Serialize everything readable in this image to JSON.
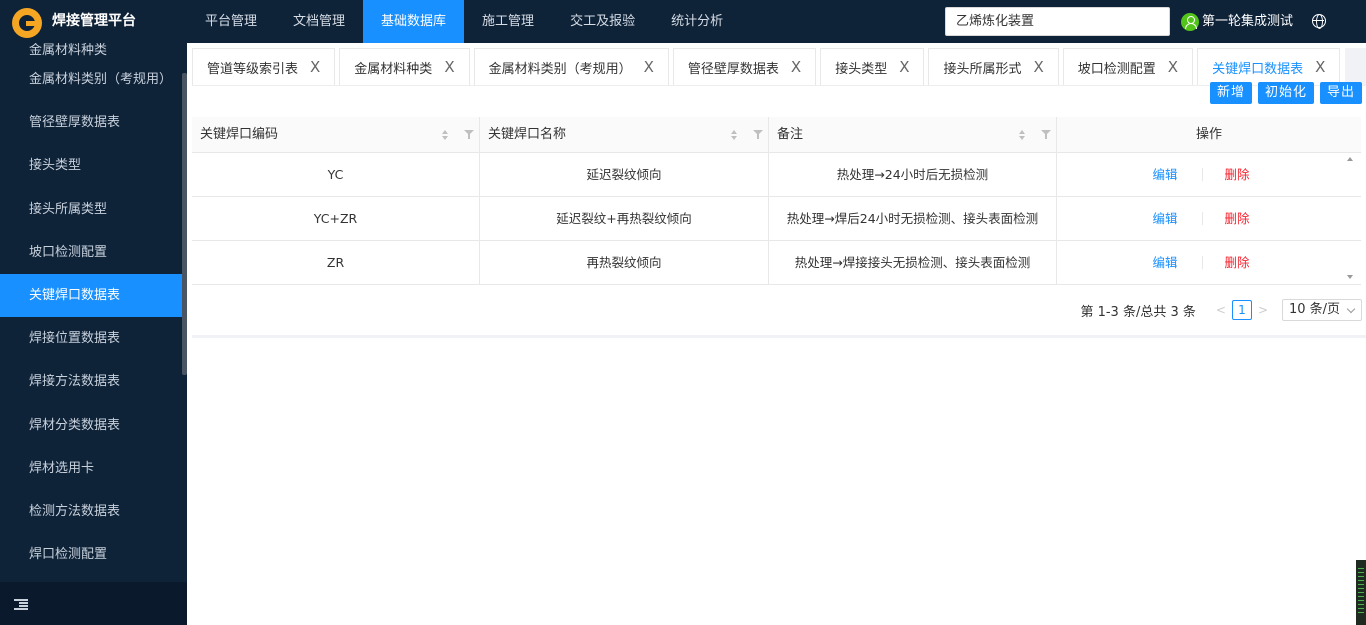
{
  "app": {
    "title": "焊接管理平台"
  },
  "nav": [
    {
      "label": "平台管理"
    },
    {
      "label": "文档管理"
    },
    {
      "label": "基础数据库",
      "active": true
    },
    {
      "label": "施工管理"
    },
    {
      "label": "交工及报验"
    },
    {
      "label": "统计分析"
    }
  ],
  "project": {
    "value": "乙烯炼化装置"
  },
  "user": {
    "name": "第一轮集成测试"
  },
  "sidebar": {
    "items": [
      {
        "label": "金属材料种类"
      },
      {
        "label": "金属材料类别（考规用）"
      },
      {
        "label": "管径壁厚数据表"
      },
      {
        "label": "接头类型"
      },
      {
        "label": "接头所属类型"
      },
      {
        "label": "坡口检测配置"
      },
      {
        "label": "关键焊口数据表",
        "active": true
      },
      {
        "label": "焊接位置数据表"
      },
      {
        "label": "焊接方法数据表"
      },
      {
        "label": "焊材分类数据表"
      },
      {
        "label": "焊材选用卡"
      },
      {
        "label": "检测方法数据表"
      },
      {
        "label": "焊口检测配置"
      }
    ]
  },
  "tabs": [
    {
      "label": "管道等级索引表"
    },
    {
      "label": "金属材料种类"
    },
    {
      "label": "金属材料类别（考规用）"
    },
    {
      "label": "管径壁厚数据表"
    },
    {
      "label": "接头类型"
    },
    {
      "label": "接头所属形式"
    },
    {
      "label": "坡口检测配置"
    },
    {
      "label": "关键焊口数据表",
      "active": true
    }
  ],
  "tab_close": "X",
  "toolbar": {
    "add": "新增",
    "init": "初始化",
    "export": "导出"
  },
  "table": {
    "columns": [
      "关键焊口编码",
      "关键焊口名称",
      "备注",
      "操作"
    ],
    "rows": [
      {
        "code": "YC",
        "name": "延迟裂纹倾向",
        "note": "热处理→24小时后无损检测"
      },
      {
        "code": "YC+ZR",
        "name": "延迟裂纹+再热裂纹倾向",
        "note": "热处理→焊后24小时无损检测、接头表面检测"
      },
      {
        "code": "ZR",
        "name": "再热裂纹倾向",
        "note": "热处理→焊接接头无损检测、接头表面检测"
      }
    ],
    "edit_label": "编辑",
    "delete_label": "删除"
  },
  "pagination": {
    "total": "第 1-3 条/总共 3 条",
    "current": "1",
    "page_size": "10 条/页"
  },
  "colors": {
    "primary": "#1890ff",
    "danger": "#f5222d",
    "nav_bg": "#0e2238"
  }
}
